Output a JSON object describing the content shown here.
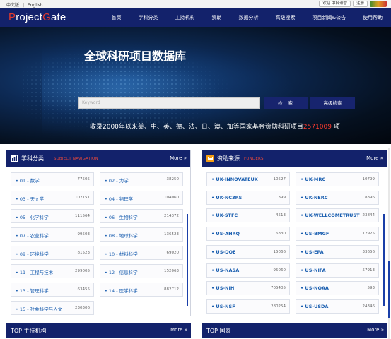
{
  "topbar": {
    "lang_zh": "中文版",
    "lang_sep": "|",
    "lang_en": "English",
    "welcome": "欢迎 中科谱智",
    "register": "注册"
  },
  "header": {
    "logo_prefix": "P",
    "logo_mid": "roject",
    "logo_g": "G",
    "logo_end": "ate",
    "nav": [
      "首页",
      "学科分类",
      "主持机构",
      "资助",
      "数据分析",
      "高级搜索",
      "项目新闻&公告",
      "使用帮助"
    ]
  },
  "hero": {
    "title": "全球科研项目数据库",
    "search_placeholder": "Keyword",
    "search_btn": "检 索",
    "adv_btn": "高级检索",
    "sub_before": "收录2000年以来美、中、英、德、法、日、澳、加等国家基金资助科研项目",
    "sub_count": "2571009",
    "sub_after": " 项"
  },
  "subjects": {
    "title": "学科分类",
    "subtitle": "SUBJECT NAVIGATION",
    "more": "More",
    "items": [
      {
        "label": "01 - 数学",
        "count": "77505"
      },
      {
        "label": "02 - 力学",
        "count": "38250"
      },
      {
        "label": "03 - 天文学",
        "count": "102151"
      },
      {
        "label": "04 - 物理学",
        "count": "104060"
      },
      {
        "label": "05 - 化学科学",
        "count": "111564"
      },
      {
        "label": "06 - 生物科学",
        "count": "214372"
      },
      {
        "label": "07 - 农业科学",
        "count": "99503"
      },
      {
        "label": "08 - 地球科学",
        "count": "136523"
      },
      {
        "label": "09 - 环境科学",
        "count": "81523"
      },
      {
        "label": "10 - 材料科学",
        "count": "69020"
      },
      {
        "label": "11 - 工程与技术",
        "count": "299005"
      },
      {
        "label": "12 - 信息科学",
        "count": "152063"
      },
      {
        "label": "13 - 管理科学",
        "count": "63455"
      },
      {
        "label": "14 - 医学科学",
        "count": "882712"
      },
      {
        "label": "15 - 社会科学与人文",
        "count": "230306"
      }
    ]
  },
  "funders": {
    "title": "资助来源",
    "subtitle": "FUNDERS",
    "more": "More",
    "items": [
      {
        "label": "UK-INNOVATEUK",
        "count": "10527"
      },
      {
        "label": "UK-MRC",
        "count": "10799"
      },
      {
        "label": "UK-NC3RS",
        "count": "399"
      },
      {
        "label": "UK-NERC",
        "count": "8896"
      },
      {
        "label": "UK-STFC",
        "count": "4513"
      },
      {
        "label": "UK-WELLCOMETRUST",
        "count": "23844"
      },
      {
        "label": "US-AHRQ",
        "count": "6330"
      },
      {
        "label": "US-BMGF",
        "count": "12925"
      },
      {
        "label": "US-DOE",
        "count": "15066"
      },
      {
        "label": "US-EPA",
        "count": "33656"
      },
      {
        "label": "US-NASA",
        "count": "95060"
      },
      {
        "label": "US-NIFA",
        "count": "57913"
      },
      {
        "label": "US-NIH",
        "count": "705405"
      },
      {
        "label": "US-NOAA",
        "count": "593"
      },
      {
        "label": "US-NSF",
        "count": "280254"
      },
      {
        "label": "US-USDA",
        "count": "24346"
      }
    ]
  },
  "bottom": {
    "left_title": "TOP 主持机构",
    "right_title": "TOP 国家",
    "more": "More"
  },
  "colors": {
    "nav_bg": "#13226b",
    "accent_red": "#e63a2c",
    "link_blue": "#1b5fb0"
  }
}
